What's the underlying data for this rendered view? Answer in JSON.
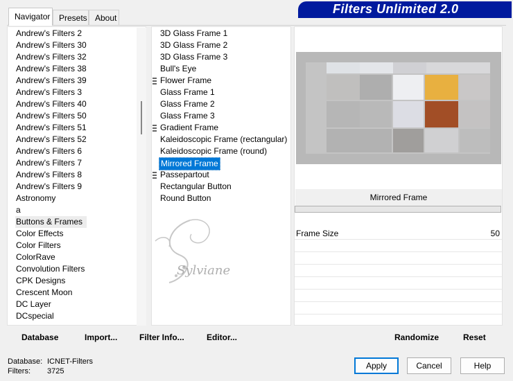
{
  "tabs": [
    {
      "label": "Navigator",
      "active": true
    },
    {
      "label": "Presets",
      "active": false
    },
    {
      "label": "About",
      "active": false
    }
  ],
  "banner": {
    "title": "Filters Unlimited 2.0"
  },
  "categories": [
    "Andrew's Filters 2",
    "Andrew's Filters 30",
    "Andrew's Filters 32",
    "Andrew's Filters 38",
    "Andrew's Filters 39",
    "Andrew's Filters 3",
    "Andrew's Filters 40",
    "Andrew's Filters 50",
    "Andrew's Filters 51",
    "Andrew's Filters 52",
    "Andrew's Filters 6",
    "Andrew's Filters 7",
    "Andrew's Filters 8",
    "Andrew's Filters 9",
    "Astronomy",
    "a",
    "Buttons & Frames",
    "Color Effects",
    "Color Filters",
    "ColorRave",
    "Convolution Filters",
    "CPK Designs",
    "Crescent Moon",
    "DC Layer",
    "DCspecial"
  ],
  "selected_category": "Buttons & Frames",
  "filters": [
    {
      "label": "3D Glass Frame 1",
      "group": false
    },
    {
      "label": "3D Glass Frame 2",
      "group": false
    },
    {
      "label": "3D Glass Frame 3",
      "group": false
    },
    {
      "label": "Bull's Eye",
      "group": false
    },
    {
      "label": "Flower Frame",
      "group": true
    },
    {
      "label": "Glass Frame 1",
      "group": false
    },
    {
      "label": "Glass Frame 2",
      "group": false
    },
    {
      "label": "Glass Frame 3",
      "group": false
    },
    {
      "label": "Gradient Frame",
      "group": true
    },
    {
      "label": "Kaleidoscopic Frame (rectangular)",
      "group": false
    },
    {
      "label": "Kaleidoscopic Frame (round)",
      "group": false
    },
    {
      "label": "Mirrored Frame",
      "group": false
    },
    {
      "label": "Passepartout",
      "group": true
    },
    {
      "label": "Rectangular Button",
      "group": false
    },
    {
      "label": "Round Button",
      "group": false
    }
  ],
  "selected_filter": "Mirrored Frame",
  "preview": {
    "filter_name": "Mirrored Frame"
  },
  "params": [
    {
      "label": "Frame Size",
      "value": "50"
    }
  ],
  "toolbar": {
    "database": "Database",
    "import": "Import...",
    "filter_info": "Filter Info...",
    "editor": "Editor...",
    "randomize": "Randomize",
    "reset": "Reset"
  },
  "status": {
    "database_label": "Database:",
    "database_value": "ICNET-Filters",
    "filters_label": "Filters:",
    "filters_value": "3725"
  },
  "buttons": {
    "apply": "Apply",
    "cancel": "Cancel",
    "help": "Help"
  },
  "watermark": {
    "text": "Sylviane"
  },
  "colors": {
    "banner": "#001a9e",
    "selection": "#0078d7",
    "accent_orange": "#e8b040",
    "accent_rust": "#a24e26"
  }
}
